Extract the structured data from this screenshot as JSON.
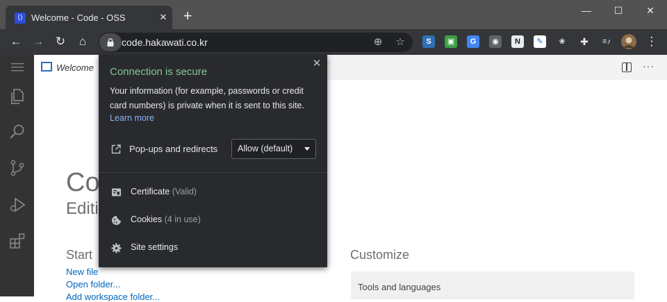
{
  "tab": {
    "title": "Welcome - Code - OSS",
    "close": "✕"
  },
  "new_tab": "+",
  "window_controls": {
    "minimize": "—",
    "maximize": "☐",
    "close": "✕"
  },
  "nav": {
    "back": "←",
    "forward": "→",
    "reload": "↻",
    "home": "⌂"
  },
  "omnibox": {
    "url": "code.hakawati.co.kr",
    "install_icon": "⊕",
    "bookmark_icon": "☆"
  },
  "extensions": [
    "S",
    "▣",
    "G",
    "◉",
    "N",
    "✎",
    "❀",
    "✚",
    "≡♪"
  ],
  "menu_icon": "⋮",
  "editor": {
    "tab_label": "Welcome",
    "more_actions": "···",
    "title": "Code - OSS",
    "subtitle": "Editing evolved",
    "start": {
      "heading": "Start",
      "links": [
        "New file",
        "Open folder...",
        "Add workspace folder..."
      ]
    },
    "customize": {
      "heading": "Customize",
      "tools_label": "Tools and languages"
    }
  },
  "page_info": {
    "title": "Connection is secure",
    "close": "✕",
    "description": "Your information (for example, passwords or credit card numbers) is private when it is sent to this site.",
    "learn_more": "Learn more",
    "popups_label": "Pop-ups and redirects",
    "popups_value": "Allow (default)",
    "rows": [
      {
        "label": "Certificate",
        "detail": "(Valid)"
      },
      {
        "label": "Cookies",
        "detail": "(4 in use)"
      },
      {
        "label": "Site settings",
        "detail": ""
      }
    ]
  },
  "colors": {
    "secure_green": "#81c995",
    "link_blue": "#8ab4f8",
    "vscode_link": "#0066bf",
    "activity_bar": "#333333"
  }
}
